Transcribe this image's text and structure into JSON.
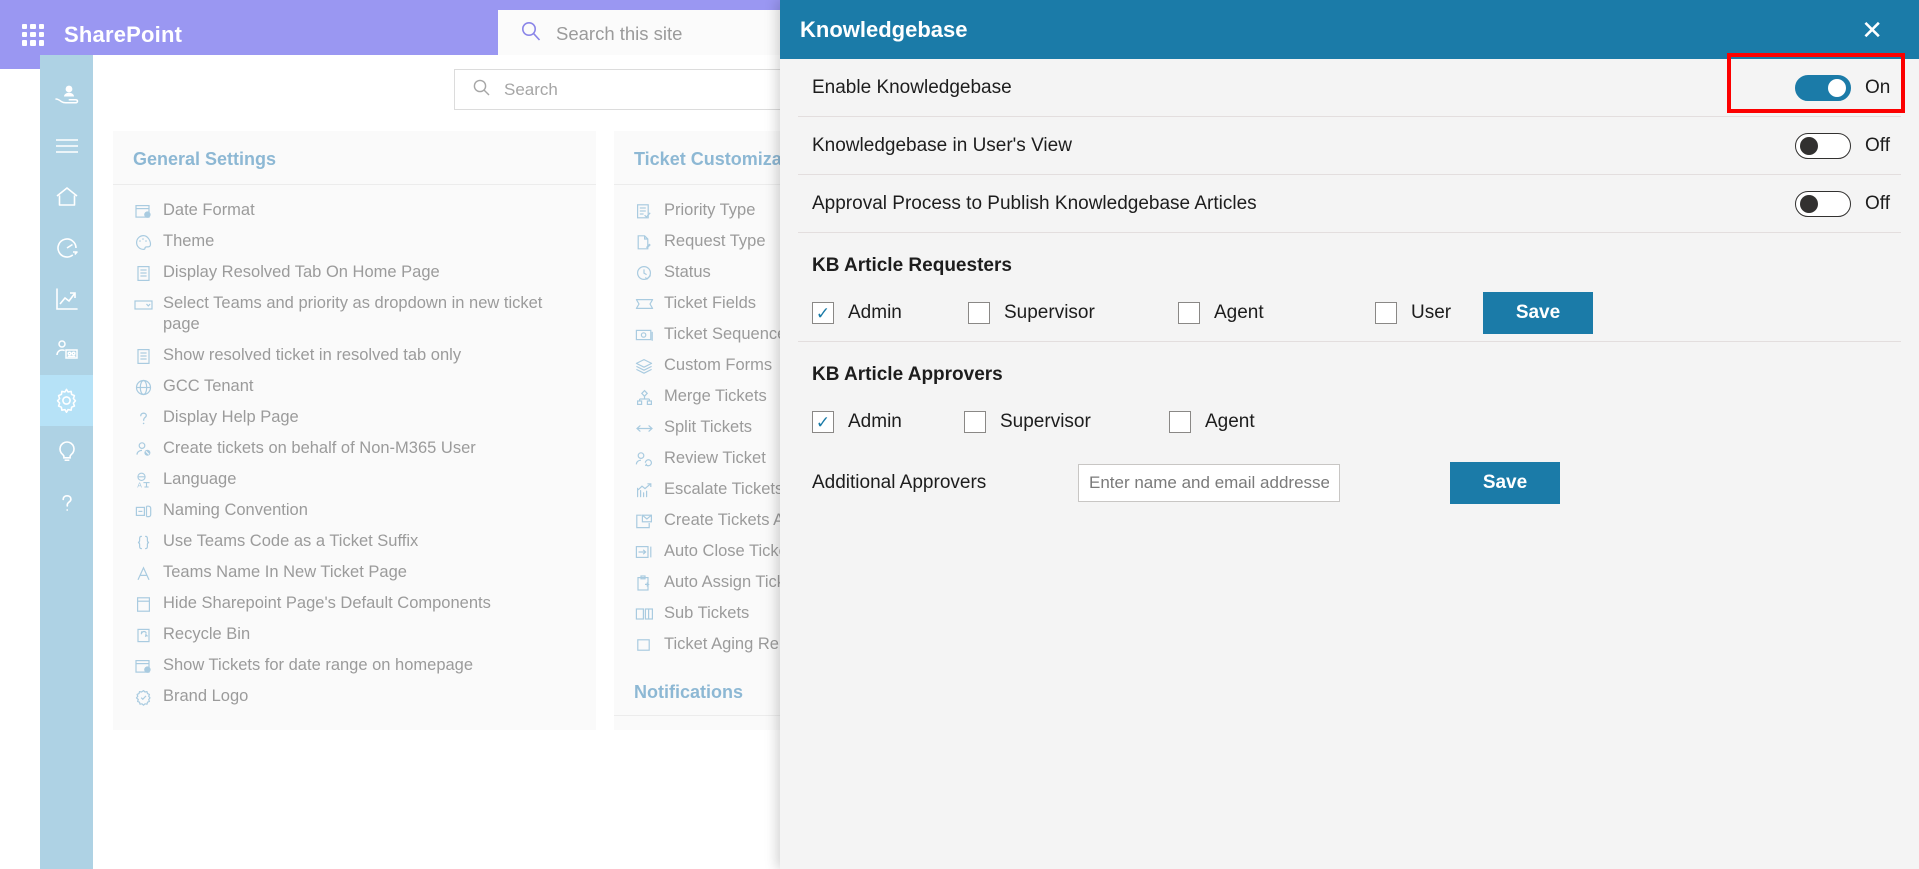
{
  "suitebar": {
    "waffle_icon": "app-launcher-icon",
    "brand": "SharePoint",
    "search_icon": "search-icon",
    "search_placeholder": "Search this site",
    "search_value": ""
  },
  "rail": {
    "items": [
      {
        "icon": "hand-user-icon",
        "name": "service-desk"
      },
      {
        "icon": "hamburger-icon",
        "name": "menu"
      },
      {
        "icon": "home-icon",
        "name": "home"
      },
      {
        "icon": "gauge-icon",
        "name": "dashboard"
      },
      {
        "icon": "chart-line-icon",
        "name": "analytics"
      },
      {
        "icon": "user-group-icon",
        "name": "teams"
      },
      {
        "icon": "gear-icon",
        "name": "settings",
        "active": true
      },
      {
        "icon": "lightbulb-icon",
        "name": "ideas"
      },
      {
        "icon": "question-icon",
        "name": "help"
      }
    ]
  },
  "page_search": {
    "icon": "search-icon",
    "placeholder": "Search",
    "value": ""
  },
  "cards": [
    {
      "title": "General Settings",
      "items": [
        {
          "label": "Date Format",
          "icon": "calendar-clock-icon"
        },
        {
          "label": "Theme",
          "icon": "palette-icon"
        },
        {
          "label": "Display Resolved Tab On Home Page",
          "icon": "document-icon"
        },
        {
          "label": "Select Teams and priority as dropdown in new ticket page",
          "icon": "dropdown-icon"
        },
        {
          "label": "Show resolved ticket in resolved tab only",
          "icon": "document-icon"
        },
        {
          "label": "GCC Tenant",
          "icon": "globe-icon"
        },
        {
          "label": "Display Help Page",
          "icon": "question-icon"
        },
        {
          "label": "Create tickets on behalf of Non-M365 User",
          "icon": "user-block-icon"
        },
        {
          "label": "Language",
          "icon": "translate-icon"
        },
        {
          "label": "Naming Convention",
          "icon": "rename-icon"
        },
        {
          "label": "Use Teams Code as a Ticket Suffix",
          "icon": "braces-icon"
        },
        {
          "label": "Teams Name In New Ticket Page",
          "icon": "letter-a-icon"
        },
        {
          "label": "Hide Sharepoint Page's Default Components",
          "icon": "page-icon"
        },
        {
          "label": "Recycle Bin",
          "icon": "trash-icon"
        },
        {
          "label": "Show Tickets for date range on homepage",
          "icon": "calendar-clock-icon"
        },
        {
          "label": "Brand Logo",
          "icon": "badge-icon"
        }
      ]
    },
    {
      "title": "Ticket Customizations",
      "sub_title": "Notifications",
      "items": [
        {
          "label": "Priority Type",
          "icon": "checklist-icon"
        },
        {
          "label": "Request Type",
          "icon": "edit-doc-icon"
        },
        {
          "label": "Status",
          "icon": "clock-check-icon"
        },
        {
          "label": "Ticket Fields",
          "icon": "ticket-icon"
        },
        {
          "label": "Ticket Sequence",
          "icon": "money-icon"
        },
        {
          "label": "Custom Forms",
          "icon": "layers-icon"
        },
        {
          "label": "Merge Tickets",
          "icon": "merge-icon"
        },
        {
          "label": "Split Tickets",
          "icon": "split-icon"
        },
        {
          "label": "Review Ticket",
          "icon": "user-review-icon"
        },
        {
          "label": "Escalate Tickets",
          "icon": "escalate-icon"
        },
        {
          "label": "Create Tickets Automatically",
          "icon": "mail-box-icon"
        },
        {
          "label": "Auto Close Tickets",
          "icon": "auto-close-icon"
        },
        {
          "label": "Auto Assign Tickets",
          "icon": "clipboard-arrow-icon"
        },
        {
          "label": "Sub Tickets",
          "icon": "columns-icon"
        },
        {
          "label": "Ticket Aging Reports",
          "icon": "square-icon"
        }
      ]
    }
  ],
  "panel": {
    "title": "Knowledgebase",
    "close_icon": "close-icon",
    "toggles": [
      {
        "label": "Enable Knowledgebase",
        "state": "On",
        "on": true,
        "highlighted": true
      },
      {
        "label": "Knowledgebase in User's View",
        "state": "Off",
        "on": false,
        "highlighted": false
      },
      {
        "label": "Approval Process to Publish Knowledgebase Articles",
        "state": "Off",
        "on": false,
        "highlighted": false
      }
    ],
    "requesters": {
      "title": "KB Article Requesters",
      "options": [
        {
          "label": "Admin",
          "checked": true
        },
        {
          "label": "Supervisor",
          "checked": false
        },
        {
          "label": "Agent",
          "checked": false
        },
        {
          "label": "User",
          "checked": false
        }
      ],
      "save_label": "Save"
    },
    "approvers": {
      "title": "KB Article Approvers",
      "options": [
        {
          "label": "Admin",
          "checked": true
        },
        {
          "label": "Supervisor",
          "checked": false
        },
        {
          "label": "Agent",
          "checked": false
        }
      ],
      "additional_label": "Additional Approvers",
      "additional_placeholder": "Enter name and email addresses",
      "additional_value": "",
      "save_label": "Save"
    }
  },
  "colors": {
    "suitebar": "#9a97f2",
    "rail": "#aed2e4",
    "rail_active": "#b6e2f7",
    "panel_header": "#1b7ba8",
    "accent": "#1b7ba8",
    "highlight": "#fc0000",
    "card_title": "#8db8d4"
  }
}
